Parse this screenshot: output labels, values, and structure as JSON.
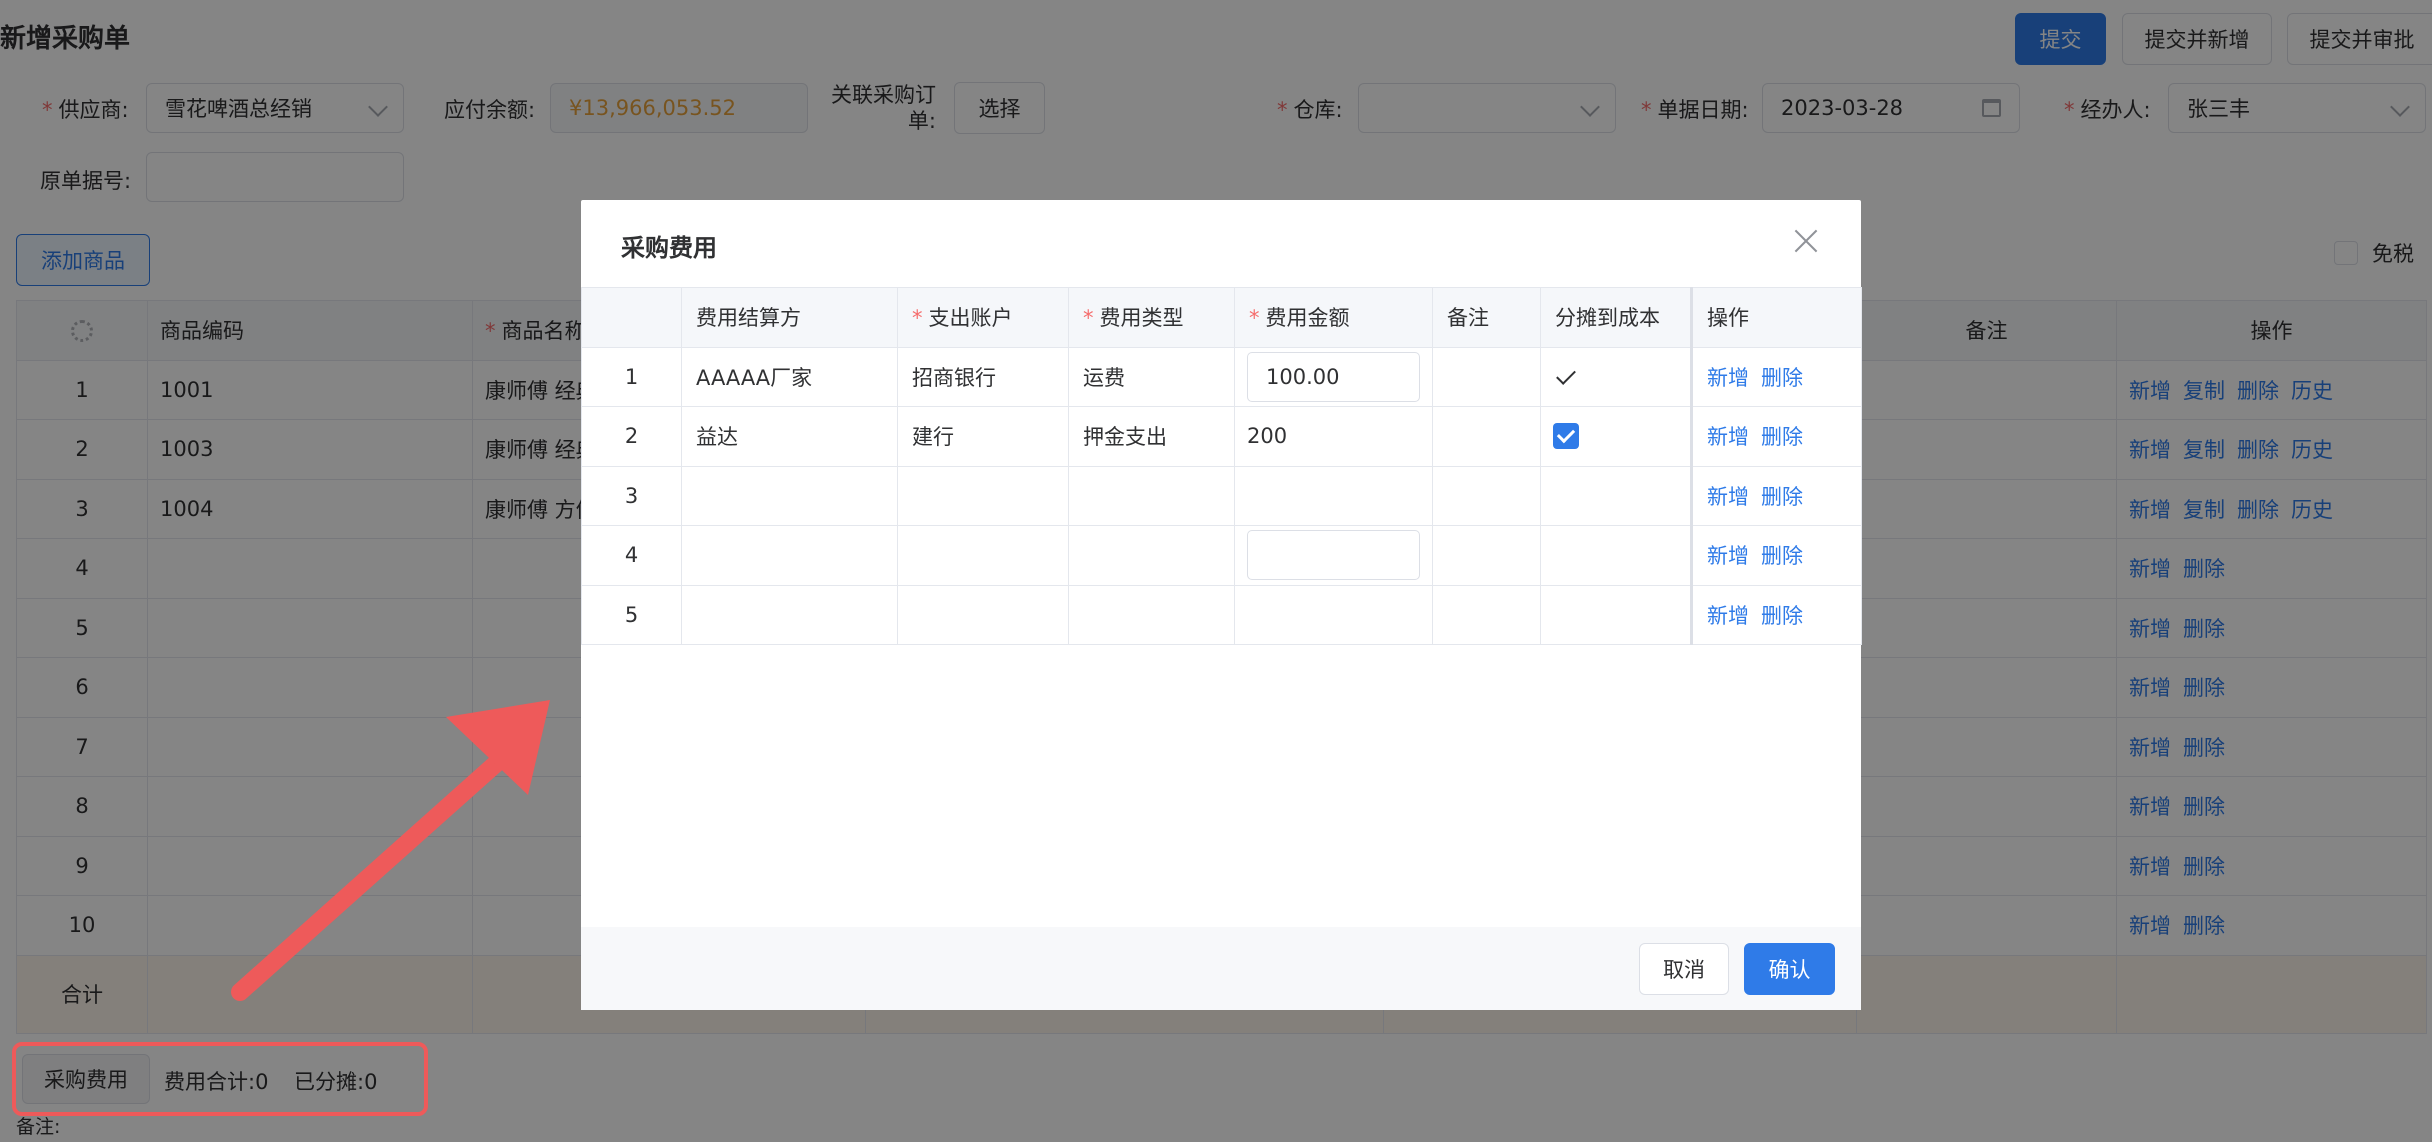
{
  "page": {
    "title": "新增采购单",
    "actions": {
      "submit": "提交",
      "submit_new": "提交并新增",
      "submit_approve": "提交并审批"
    }
  },
  "form": {
    "supplier": {
      "label": "供应商:",
      "value": "雪花啤酒总经销"
    },
    "payable": {
      "label": "应付余额:",
      "value": "¥13,966,053.52"
    },
    "related_order": {
      "label_line1": "关联采购订",
      "label_line2": "单:",
      "button": "选择"
    },
    "warehouse": {
      "label": "仓库:",
      "value": ""
    },
    "doc_date": {
      "label": "单据日期:",
      "value": "2023-03-28"
    },
    "handler": {
      "label": "经办人:",
      "value": "张三丰"
    },
    "original_no": {
      "label": "原单据号:",
      "value": ""
    }
  },
  "toolbar": {
    "add_goods": "添加商品",
    "tax_free": "免税"
  },
  "main_table": {
    "headers": {
      "code": "商品编码",
      "name": "商品名称",
      "remark": "备注",
      "ops": "操作"
    },
    "rows": [
      {
        "no": "1",
        "code": "1001",
        "name": "康师傅 经典",
        "ops": [
          "新增",
          "复制",
          "删除",
          "历史"
        ]
      },
      {
        "no": "2",
        "code": "1003",
        "name": "康师傅 经典",
        "ops": [
          "新增",
          "复制",
          "删除",
          "历史"
        ]
      },
      {
        "no": "3",
        "code": "1004",
        "name": "康师傅 方便",
        "ops": [
          "新增",
          "复制",
          "删除",
          "历史"
        ]
      },
      {
        "no": "4",
        "code": "",
        "name": "",
        "ops": [
          "新增",
          "删除"
        ]
      },
      {
        "no": "5",
        "code": "",
        "name": "",
        "ops": [
          "新增",
          "删除"
        ]
      },
      {
        "no": "6",
        "code": "",
        "name": "",
        "ops": [
          "新增",
          "删除"
        ]
      },
      {
        "no": "7",
        "code": "",
        "name": "",
        "ops": [
          "新增",
          "删除"
        ]
      },
      {
        "no": "8",
        "code": "",
        "name": "",
        "ops": [
          "新增",
          "删除"
        ]
      },
      {
        "no": "9",
        "code": "",
        "name": "",
        "ops": [
          "新增",
          "删除"
        ]
      },
      {
        "no": "10",
        "code": "",
        "name": "",
        "ops": [
          "新增",
          "删除"
        ]
      }
    ],
    "sum_label": "合计"
  },
  "footer": {
    "fee_button": "采购费用",
    "fee_total": "费用合计:0",
    "allocated": "已分摊:0",
    "remark_label": "备注:"
  },
  "dialog": {
    "title": "采购费用",
    "headers": {
      "payee": "费用结算方",
      "account": "支出账户",
      "type": "费用类型",
      "amount": "费用金额",
      "remark": "备注",
      "allocate": "分摊到成本",
      "ops": "操作"
    },
    "rows": [
      {
        "no": "1",
        "payee": "AAAAA厂家",
        "account": "招商银行",
        "type": "运费",
        "amount": "100.00",
        "ops": [
          "新增",
          "删除"
        ]
      },
      {
        "no": "2",
        "payee": "益达",
        "account": "建行",
        "type": "押金支出",
        "amount": "200",
        "ops": [
          "新增",
          "删除"
        ]
      },
      {
        "no": "3",
        "payee": "",
        "account": "",
        "type": "",
        "amount": "",
        "ops": [
          "新增",
          "删除"
        ]
      },
      {
        "no": "4",
        "payee": "",
        "account": "",
        "type": "",
        "amount": "",
        "ops": [
          "新增",
          "删除"
        ]
      },
      {
        "no": "5",
        "payee": "",
        "account": "",
        "type": "",
        "amount": "",
        "ops": [
          "新增",
          "删除"
        ]
      }
    ],
    "cancel": "取消",
    "confirm": "确认"
  },
  "colors": {
    "primary": "#2f7be8",
    "required": "#f56c6c",
    "amount": "#e6a23c",
    "annotation": "#ee5a5a"
  }
}
